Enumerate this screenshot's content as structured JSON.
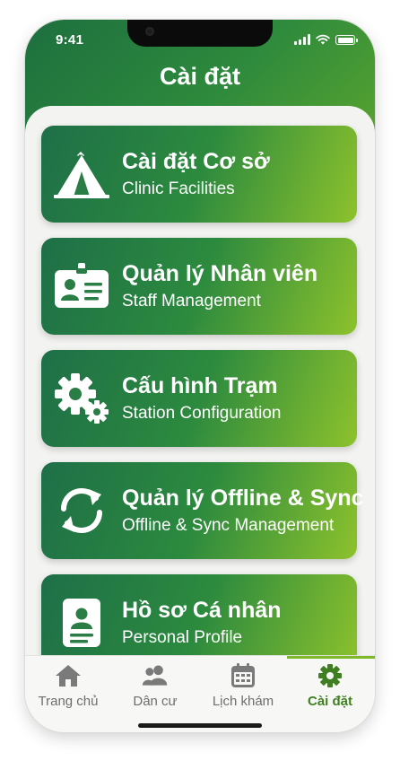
{
  "status_bar": {
    "time": "9:41"
  },
  "header": {
    "title": "Cài đặt"
  },
  "menu": [
    {
      "title": "Cài đặt Cơ sở",
      "subtitle": "Clinic Facilities",
      "icon": "tent-icon"
    },
    {
      "title": "Quản lý Nhân viên",
      "subtitle": "Staff Management",
      "icon": "id-card-icon"
    },
    {
      "title": "Cấu hình Trạm",
      "subtitle": "Station Configuration",
      "icon": "gears-icon"
    },
    {
      "title": "Quản lý Offline & Sync",
      "subtitle": "Offline & Sync Management",
      "icon": "sync-icon"
    },
    {
      "title": "Hồ sơ Cá nhân",
      "subtitle": "Personal Profile",
      "icon": "profile-icon"
    }
  ],
  "nav": {
    "items": [
      {
        "label": "Trang chủ",
        "icon": "home-icon"
      },
      {
        "label": "Dân cư",
        "icon": "users-icon"
      },
      {
        "label": "Lịch khám",
        "icon": "calendar-icon"
      },
      {
        "label": "Cài đặt",
        "icon": "gear-icon"
      }
    ],
    "active_index": 3
  },
  "colors": {
    "brand_dark": "#1e6f48",
    "brand_light": "#8dc22c",
    "active_nav": "#3f7f22",
    "inactive_nav": "#7a7a7a"
  }
}
